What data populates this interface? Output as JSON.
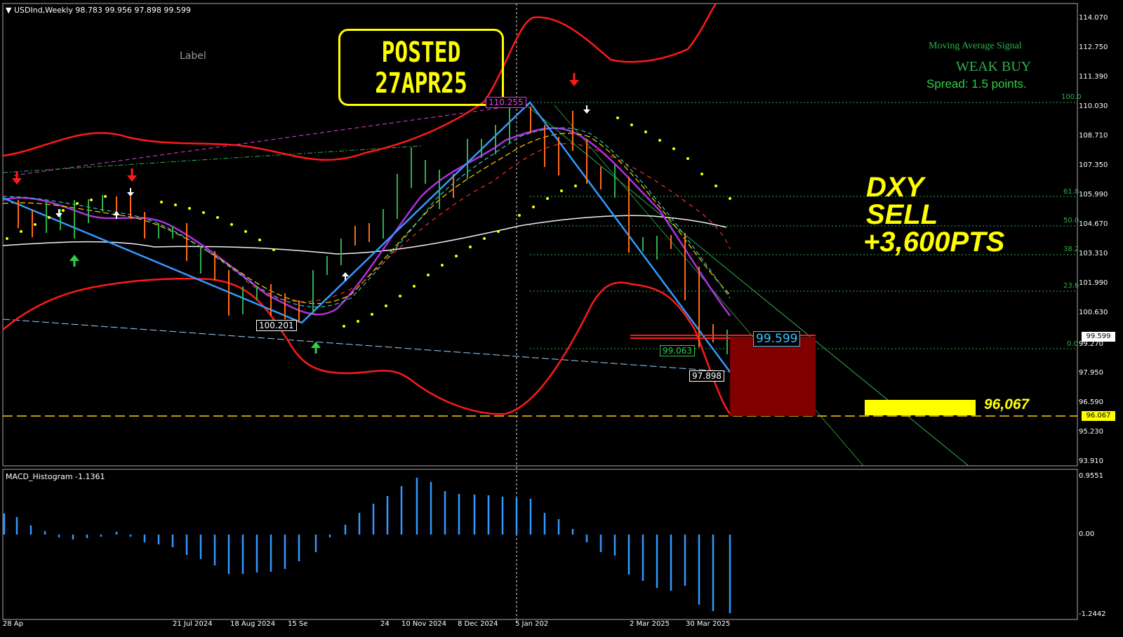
{
  "header": {
    "symbol_info": "USDInd,Weekly  98.783 99.956 97.898 99.599",
    "macd_label": "MACD_Histogram -1.1361"
  },
  "annotations": {
    "posted_line1": "POSTED",
    "posted_line2": "27APR25",
    "label_text": "Label",
    "big_line1": "DXY",
    "big_line2": "SELL",
    "big_line3": "+3,600PTS",
    "target_value": "96,067",
    "ma_signal_title": "Moving Average Signal",
    "ma_signal_value": "WEAK BUY",
    "spread_text": "Spread: 1.5 points."
  },
  "chart_labels": {
    "high_label": "110.255",
    "low_label_left": "100.201",
    "low_label_right": "97.898",
    "box_label_99063": "99.063",
    "box_label_current": "99.599",
    "fib_100": "100.0",
    "fib_618": "61.8",
    "fib_50": "50.0",
    "fib_382": "38.2",
    "fib_236": "23.6",
    "fib_0": "0.0"
  },
  "price_axis": [
    "114.070",
    "112.750",
    "111.390",
    "110.030",
    "108.710",
    "107.350",
    "105.990",
    "104.670",
    "103.310",
    "101.990",
    "100.630",
    "99.270",
    "97.950",
    "96.590",
    "95.230",
    "93.910"
  ],
  "current_price_tag": "99.599",
  "target_price_tag": "96.067",
  "macd_axis": [
    "0.9551",
    "0.00",
    "-1.2442"
  ],
  "x_axis": [
    "28 Ap",
    "21 Jul 2024",
    "18 Aug 2024",
    "15 Se",
    "24",
    "10 Nov 2024",
    "8 Dec 2024",
    "5 Jan 202",
    "2 Mar 2025",
    "30 Mar 2025"
  ],
  "colors": {
    "background": "#000000",
    "bollinger": "#ff1a1a",
    "zigzag": "#3399ff",
    "ma_purple": "#b030e0",
    "highlight": "#ffff00",
    "signal_green": "#2fb04a",
    "macd_bars": "#3399ff",
    "sell_box": "#800000"
  },
  "icons": [
    "sell-arrow-icon",
    "buy-arrow-icon",
    "dropdown-triangle-icon"
  ]
}
